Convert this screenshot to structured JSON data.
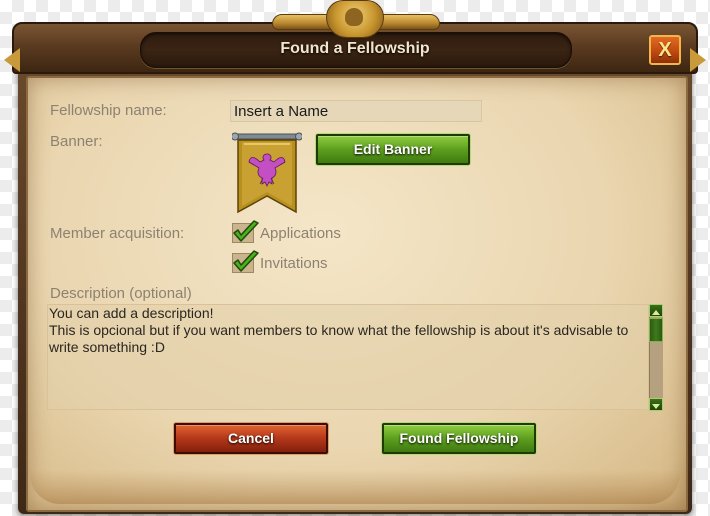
{
  "dialog": {
    "title": "Found a Fellowship",
    "close_label": "X"
  },
  "form": {
    "name_label": "Fellowship name:",
    "name_value": "Insert a Name",
    "banner_label": "Banner:",
    "edit_banner_label": "Edit Banner",
    "acquisition_label": "Member acquisition:",
    "options": [
      {
        "label": "Applications",
        "checked": true
      },
      {
        "label": "Invitations",
        "checked": true
      }
    ],
    "description_label": "Description (optional)",
    "description_text": "You can add a description!\nThis is opcional but if you want members to know what the fellowship is about it's advisable to write something :D"
  },
  "actions": {
    "cancel_label": "Cancel",
    "found_label": "Found Fellowship"
  },
  "colors": {
    "accent_green": "#5d9f1e",
    "cancel_red": "#b3371a",
    "parchment": "#ead6b0",
    "wood": "#5b3b20",
    "banner_gold": "#b8901e",
    "emblem_purple": "#c44fc4"
  },
  "icons": {
    "close": "close-icon",
    "checkbox": "checkmark-icon",
    "banner": "eagle-banner-icon",
    "scroll_up": "arrow-up-icon",
    "scroll_down": "arrow-down-icon"
  }
}
